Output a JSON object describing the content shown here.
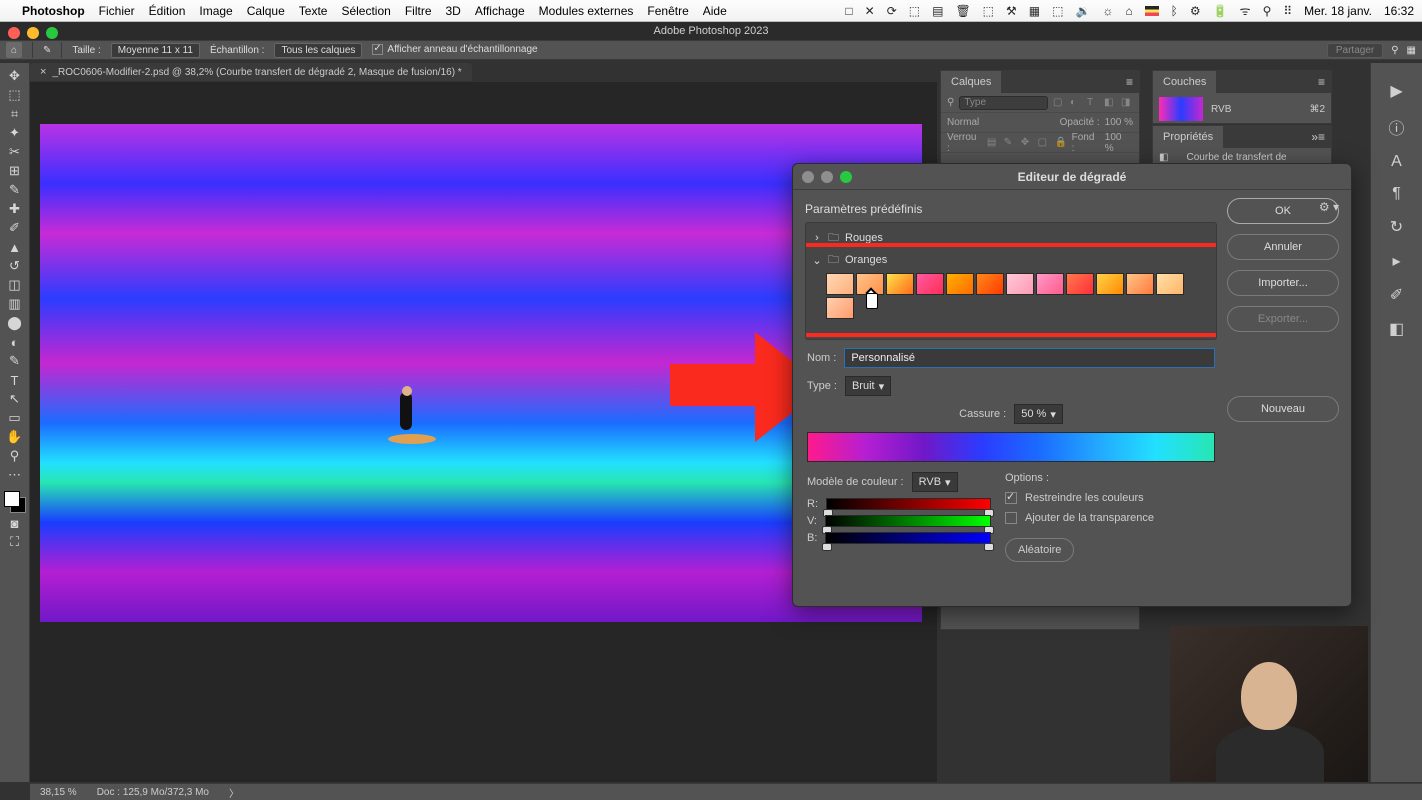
{
  "mac_menu": {
    "app": "Photoshop",
    "items": [
      "Fichier",
      "Édition",
      "Image",
      "Calque",
      "Texte",
      "Sélection",
      "Filtre",
      "3D",
      "Affichage",
      "Modules externes",
      "Fenêtre",
      "Aide"
    ],
    "right_icons": [
      "□",
      "✕",
      "⟳",
      "✪",
      "◧",
      "■",
      "⬚",
      "✎",
      "♪",
      "⏏",
      "⚙",
      "◧",
      "↻",
      "★",
      "▮",
      "⚡",
      "⌨",
      "⌃",
      "ᯅ",
      "⚲",
      "≡"
    ],
    "date": "Mer. 18 janv.",
    "time": "16:32"
  },
  "app_title": "Adobe Photoshop 2023",
  "options_bar": {
    "size_label": "Taille :",
    "size_value": "Moyenne 11 x 11",
    "sample_label": "Échantillon :",
    "sample_value": "Tous les calques",
    "show_ring": "Afficher anneau d'échantillonnage",
    "share": "Partager"
  },
  "doc_tab": "_ROC0606-Modifier-2.psd @ 38,2% (Courbe transfert de dégradé 2, Masque de fusion/16) *",
  "tools": [
    "⬚",
    "◌",
    "⊕",
    "✂",
    "⤢",
    "✎",
    "✐",
    "⌫",
    "⟲",
    "◧",
    "⟋",
    "◔",
    "⊡",
    "◨",
    "◆",
    "✥",
    "✎",
    "T",
    "▷",
    "⊞",
    "⬚",
    "✋",
    "⚲"
  ],
  "statusbar": {
    "zoom": "38,15 %",
    "docinfo": "Doc : 125,9 Mo/372,3 Mo"
  },
  "panels": {
    "calques": {
      "tab": "Calques",
      "type_label": "Type",
      "mode": "Normal",
      "opacity_label": "Opacité :",
      "opacity_value": "100 %",
      "lock_label": "Verrou :",
      "fill_label": "Fond :",
      "fill_value": "100 %"
    },
    "couches": {
      "tab": "Couches",
      "channel": "RVB",
      "shortcut": "⌘2"
    },
    "props": {
      "tab": "Propriétés",
      "layer_type": "Courbe de transfert de dégradé"
    }
  },
  "dialog": {
    "title": "Editeur de dégradé",
    "presets_label": "Paramètres prédéfinis",
    "folder_rouges": "Rouges",
    "folder_oranges": "Oranges",
    "ok": "OK",
    "cancel": "Annuler",
    "import": "Importer...",
    "export": "Exporter...",
    "new": "Nouveau",
    "name_label": "Nom :",
    "name_value": "Personnalisé",
    "type_label": "Type :",
    "type_value": "Bruit",
    "rough_label": "Cassure :",
    "rough_value": "50 %",
    "model_label": "Modèle de couleur :",
    "model_value": "RVB",
    "r": "R:",
    "g": "V:",
    "b": "B:",
    "opts_label": "Options :",
    "restrict": "Restreindre les couleurs",
    "transparency": "Ajouter de la transparence",
    "random": "Aléatoire",
    "swatches": [
      "linear-gradient(135deg,#ffd7b5,#ffb07a)",
      "linear-gradient(135deg,#ffc58a,#ff8f4a)",
      "linear-gradient(135deg,#ffe24a,#ff6a1a)",
      "linear-gradient(135deg,#ff5aa0,#ff2d55)",
      "linear-gradient(135deg,#ffb000,#ff6a00)",
      "linear-gradient(135deg,#ff8a1a,#ff3a00)",
      "linear-gradient(135deg,#ffc8d6,#ff9ab5)",
      "linear-gradient(135deg,#ff9ac8,#ff5a8a)",
      "linear-gradient(135deg,#ff7a4a,#ff2d3a)",
      "linear-gradient(135deg,#ffd24a,#ff8a00)",
      "linear-gradient(135deg,#ffc58a,#ff7a3a)",
      "linear-gradient(135deg,#ffe0a8,#ffb56a)",
      "linear-gradient(135deg,#ffd0b0,#ff9a6a)"
    ]
  }
}
